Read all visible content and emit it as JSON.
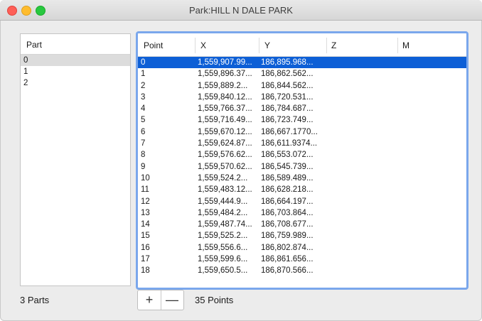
{
  "window": {
    "title": "Park:HILL N DALE PARK"
  },
  "parts": {
    "header": "Part",
    "rows": [
      "0",
      "1",
      "2"
    ],
    "selected_index": 0,
    "count_label": "3 Parts"
  },
  "points": {
    "columns": [
      "Point",
      "X",
      "Y",
      "Z",
      "M"
    ],
    "rows": [
      {
        "point": "0",
        "x": "1,559,907.99...",
        "y": "186,895.968..."
      },
      {
        "point": "1",
        "x": "1,559,896.37...",
        "y": "186,862.562..."
      },
      {
        "point": "2",
        "x": "1,559,889.2...",
        "y": "186,844.562..."
      },
      {
        "point": "3",
        "x": "1,559,840.12...",
        "y": "186,720.531..."
      },
      {
        "point": "4",
        "x": "1,559,766.37...",
        "y": "186,784.687..."
      },
      {
        "point": "5",
        "x": "1,559,716.49...",
        "y": "186,723.749..."
      },
      {
        "point": "6",
        "x": "1,559,670.12...",
        "y": "186,667.1770..."
      },
      {
        "point": "7",
        "x": "1,559,624.87...",
        "y": "186,611.9374..."
      },
      {
        "point": "8",
        "x": "1,559,576.62...",
        "y": "186,553.072..."
      },
      {
        "point": "9",
        "x": "1,559,570.62...",
        "y": "186,545.739..."
      },
      {
        "point": "10",
        "x": "1,559,524.2...",
        "y": "186,589.489..."
      },
      {
        "point": "11",
        "x": "1,559,483.12...",
        "y": "186,628.218..."
      },
      {
        "point": "12",
        "x": "1,559,444.9...",
        "y": "186,664.197..."
      },
      {
        "point": "13",
        "x": "1,559,484.2...",
        "y": "186,703.864..."
      },
      {
        "point": "14",
        "x": "1,559,487.74...",
        "y": "186,708.677..."
      },
      {
        "point": "15",
        "x": "1,559,525.2...",
        "y": "186,759.989..."
      },
      {
        "point": "16",
        "x": "1,559,556.6...",
        "y": "186,802.874..."
      },
      {
        "point": "17",
        "x": "1,559,599.6...",
        "y": "186,861.656..."
      },
      {
        "point": "18",
        "x": "1,559,650.5...",
        "y": "186,870.566..."
      }
    ],
    "selected_index": 0,
    "count_label": "35 Points"
  },
  "buttons": {
    "add_label": "+",
    "remove_label": "—"
  },
  "colors": {
    "selection": "#0d5fd6",
    "focus_ring": "#7aa7ec"
  }
}
